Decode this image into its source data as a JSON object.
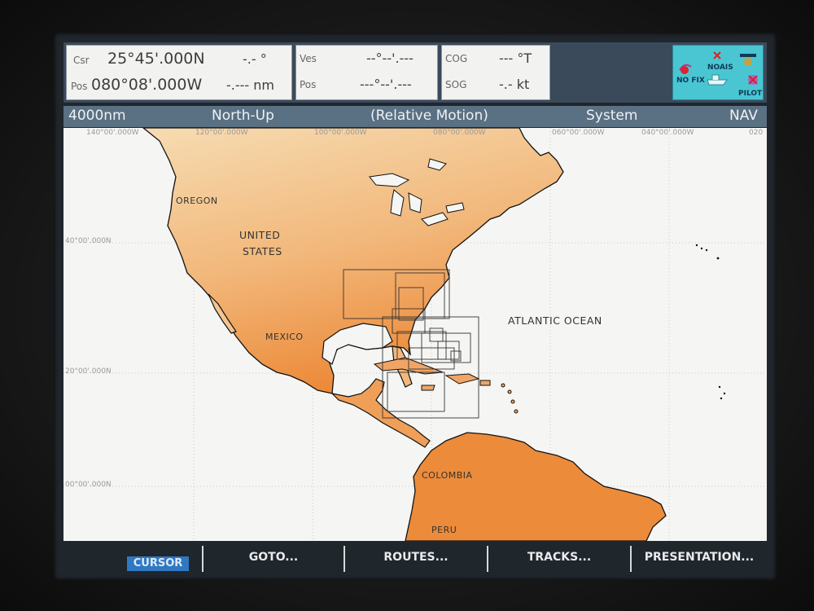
{
  "databar": {
    "csr_label": "Csr",
    "csr_lat": "25°45'.000N",
    "csr_bearing": "-.- °",
    "pos_label": "Pos",
    "pos_lon": "080°08'.000W",
    "pos_range": "-.--- nm",
    "ves_label": "Ves",
    "ves_value": "--°--'.---",
    "ves_pos_label": "Pos",
    "ves_pos_value": "---°--'.---",
    "cog_label": "COG",
    "cog_value": "--- °T",
    "sog_label": "SOG",
    "sog_value": "-.- kt"
  },
  "status": {
    "no_fix": "NO FIX",
    "no_ais": "NOAIS",
    "pilot": "PILOT"
  },
  "titlebar": {
    "range": "4000nm",
    "orientation": "North-Up",
    "motion": "(Relative Motion)",
    "mode": "System",
    "nav": "NAV"
  },
  "map": {
    "labels": {
      "oregon": "OREGON",
      "united": "UNITED",
      "states": "STATES",
      "mexico": "MEXICO",
      "atlantic": "ATLANTIC OCEAN",
      "colombia": "COLOMBIA",
      "peru": "PERU"
    },
    "grid": {
      "lon_140": "140°00'.000W",
      "lon_120": "120°00'.000W",
      "lon_100": "100°00'.000W",
      "lon_080": "080°00'.000W",
      "lon_060": "060°00'.000W",
      "lon_040": "040°00'.000W",
      "lon_020": "020",
      "lat_40": "40°00'.000N",
      "lat_20": "20°00'.000N",
      "lat_00": "00°00'.000N"
    },
    "colors": {
      "land_light": "#f5d3a4",
      "land_dark": "#ef8c3a",
      "water": "#f5f5f3",
      "coast": "#111111"
    }
  },
  "softkeys": {
    "cursor": "CURSOR",
    "goto": "GOTO...",
    "routes": "ROUTES...",
    "tracks": "TRACKS...",
    "presentation": "PRESENTATION..."
  }
}
